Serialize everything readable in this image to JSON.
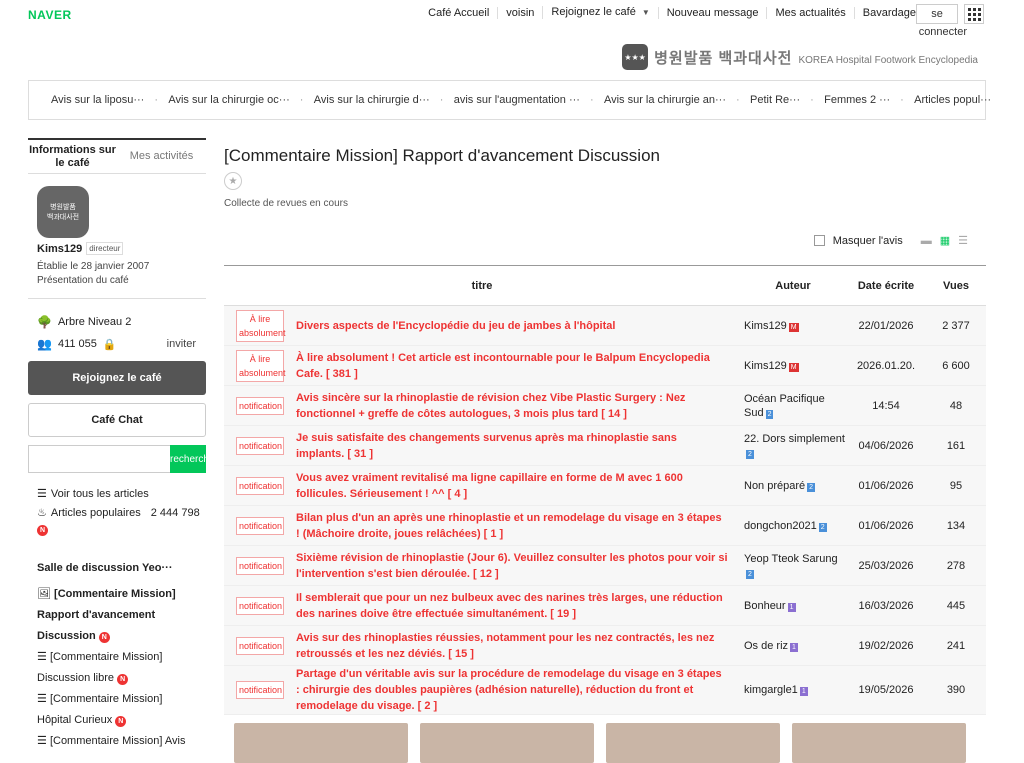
{
  "brand": "NAVER",
  "gnb": {
    "links": [
      "Café Accueil",
      "voisin",
      "Rejoignez le café",
      "Nouveau message",
      "Mes actualités",
      "Bavardage"
    ],
    "input": "se",
    "connect": "connecter"
  },
  "banner": {
    "kr": "병원발품 백과대사전",
    "en": "KOREA Hospital Footwork Encyclopedia"
  },
  "menu": [
    "Avis sur la liposu···",
    "Avis sur la chirurgie oc···",
    "Avis sur la chirurgie d···",
    "avis sur l'augmentation ···",
    "Avis sur la chirurgie an···",
    "Petit Re···",
    "Femmes 2 ···",
    "Articles popul···"
  ],
  "side": {
    "tabs": [
      "Informations sur le café",
      "Mes activités"
    ],
    "manager": "Kims129",
    "manager_tag": "directeur",
    "since": "Établie le 28 janvier 2007",
    "intro": "Présentation du café",
    "level": "Arbre Niveau 2",
    "members": "411 055",
    "invite": "inviter",
    "join": "Rejoignez le café",
    "chat": "Café Chat",
    "search_btn": "recherche",
    "all": "Voir tous les articles",
    "popular": "Articles populaires",
    "popular_count": "2 444 798",
    "board": "Salle de discussion Yeo···"
  },
  "blist": [
    {
      "a": "[Commentaire Mission]",
      "b": "Rapport d'avancement",
      "c": "Discussion"
    },
    {
      "a": "[Commentaire Mission]",
      "c": "Discussion libre"
    },
    {
      "a": "[Commentaire Mission]",
      "c": "Hôpital Curieux"
    },
    {
      "a": "[Commentaire Mission] Avis"
    }
  ],
  "main": {
    "title": "[Commentaire Mission] Rapport d'avancement Discussion",
    "subtitle": "Collecte de revues en cours",
    "hide": "Masquer l'avis",
    "headers": [
      "titre",
      "Auteur",
      "Date écrite",
      "Vues"
    ]
  },
  "rows": [
    {
      "label": "À lire absolument",
      "title": "Divers aspects de l'Encyclopédie du jeu de jambes à l'hôpital",
      "author": "Kims129",
      "lv": "M",
      "date": "22/01/2026",
      "views": "2 377"
    },
    {
      "label": "À lire absolument",
      "title": "À lire absolument ! Cet article est incontournable pour le Balpum Encyclopedia Cafe. [ 381 ]",
      "author": "Kims129",
      "lv": "M",
      "date": "2026.01.20.",
      "views": "6 600"
    },
    {
      "label": "notification",
      "title": "Avis sincère sur la rhinoplastie de révision chez Vibe Plastic Surgery : Nez fonctionnel + greffe de côtes autologues, 3 mois plus tard [ 14 ]",
      "author": "Océan Pacifique Sud",
      "lv": "2",
      "date": "14:54",
      "views": "48"
    },
    {
      "label": "notification",
      "title": "Je suis satisfaite des changements survenus après ma rhinoplastie sans implants. [ 31 ]",
      "author": "22. Dors simplement",
      "lv": "2",
      "date": "04/06/2026",
      "views": "161"
    },
    {
      "label": "notification",
      "title": "Vous avez vraiment revitalisé ma ligne capillaire en forme de M avec 1 600 follicules. Sérieusement ! ^^ [ 4 ]",
      "author": "Non préparé",
      "lv": "2",
      "date": "01/06/2026",
      "views": "95"
    },
    {
      "label": "notification",
      "title": "Bilan plus d'un an après une rhinoplastie et un remodelage du visage en 3 étapes ! (Mâchoire droite, joues relâchées) [ 1 ]",
      "author": "dongchon2021",
      "lv": "2",
      "date": "01/06/2026",
      "views": "134"
    },
    {
      "label": "notification",
      "title": "Sixième révision de rhinoplastie (Jour 6). Veuillez consulter les photos pour voir si l'intervention s'est bien déroulée. [ 12 ]",
      "author": "Yeop Tteok Sarung",
      "lv": "2",
      "date": "25/03/2026",
      "views": "278"
    },
    {
      "label": "notification",
      "title": "Il semblerait que pour un nez bulbeux avec des narines très larges, une réduction des narines doive être effectuée simultanément. [ 19 ]",
      "author": "Bonheur",
      "lv": "1",
      "date": "16/03/2026",
      "views": "445"
    },
    {
      "label": "notification",
      "title": "Avis sur des rhinoplasties réussies, notamment pour les nez contractés, les nez retroussés et les nez déviés. [ 15 ]",
      "author": "Os de riz",
      "lv": "1",
      "date": "19/02/2026",
      "views": "241"
    },
    {
      "label": "notification",
      "title": "Partage d'un véritable avis sur la procédure de remodelage du visage en 3 étapes : chirurgie des doubles paupières (adhésion naturelle), réduction du front et remodelage du visage. [ 2 ]",
      "author": "kimgargle1",
      "lv": "1",
      "date": "19/05/2026",
      "views": "390"
    }
  ]
}
